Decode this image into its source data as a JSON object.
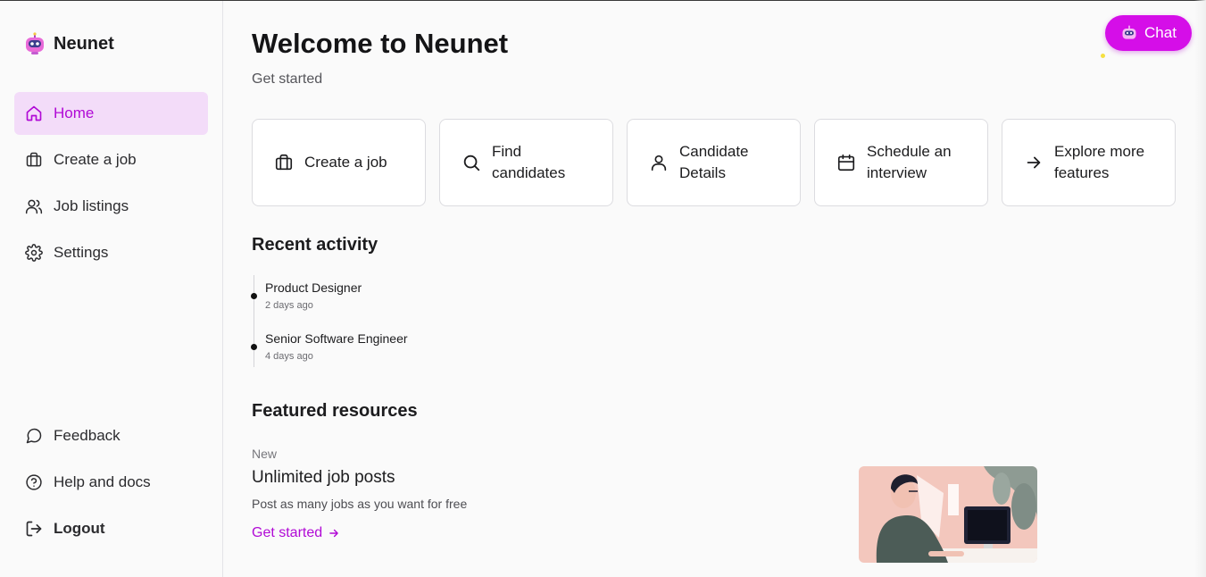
{
  "app": {
    "name": "Neunet"
  },
  "sidebar": {
    "items": [
      {
        "label": "Home",
        "icon": "home-icon",
        "active": true
      },
      {
        "label": "Create a job",
        "icon": "briefcase-icon",
        "active": false
      },
      {
        "label": "Job listings",
        "icon": "users-icon",
        "active": false
      },
      {
        "label": "Settings",
        "icon": "gear-icon",
        "active": false
      }
    ],
    "bottom": [
      {
        "label": "Feedback",
        "icon": "message-icon"
      },
      {
        "label": "Help and docs",
        "icon": "help-icon"
      },
      {
        "label": "Logout",
        "icon": "logout-icon"
      }
    ]
  },
  "header": {
    "title": "Welcome to Neunet",
    "subtitle": "Get started"
  },
  "quick_actions": [
    {
      "label": "Create a job",
      "icon": "briefcase-icon"
    },
    {
      "label": "Find candidates",
      "icon": "search-icon"
    },
    {
      "label": "Candidate Details",
      "icon": "user-icon"
    },
    {
      "label": "Schedule an interview",
      "icon": "calendar-icon"
    },
    {
      "label": "Explore more features",
      "icon": "arrow-right-icon"
    }
  ],
  "recent_activity": {
    "title": "Recent activity",
    "items": [
      {
        "title": "Product Designer",
        "time": "2 days ago"
      },
      {
        "title": "Senior Software Engineer",
        "time": "4 days ago"
      }
    ]
  },
  "featured": {
    "title": "Featured resources",
    "badge": "New",
    "heading": "Unlimited job posts",
    "description": "Post as many jobs as you want for free",
    "link": "Get started"
  },
  "chat": {
    "label": "Chat"
  },
  "colors": {
    "accent": "#b10ad6",
    "chat": "#d50ee8",
    "active_bg": "#f3dcf9"
  }
}
